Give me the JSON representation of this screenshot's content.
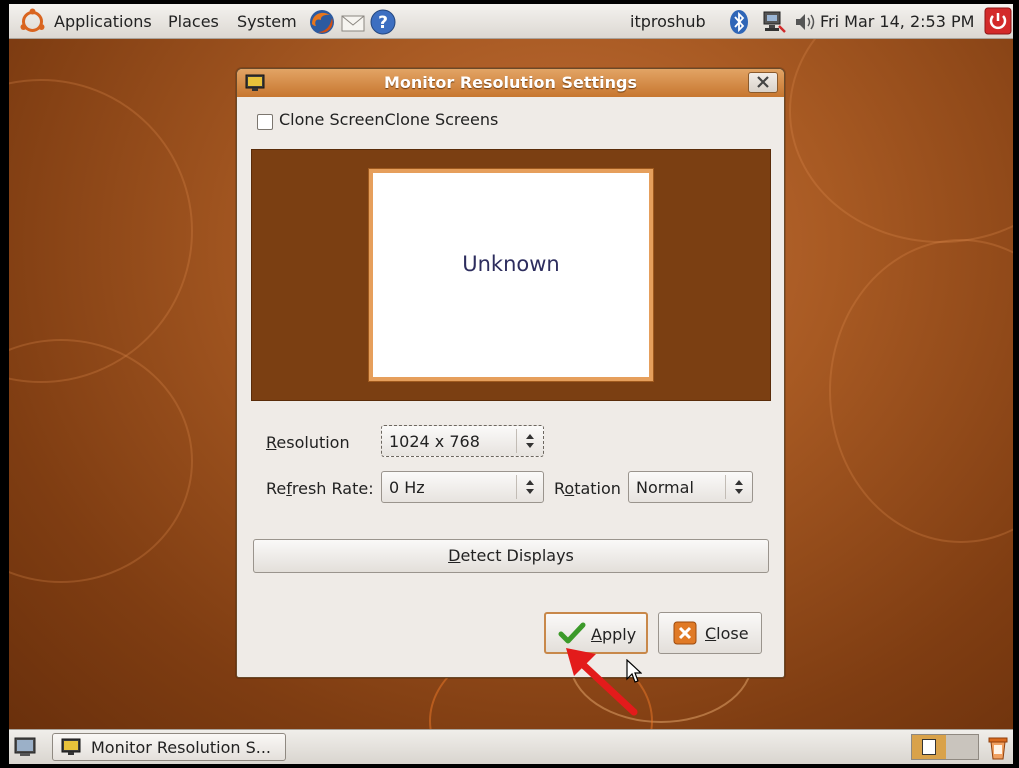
{
  "top_panel": {
    "menus": [
      "Applications",
      "Places",
      "System"
    ],
    "username": "itproshub",
    "clock": "Fri Mar 14,  2:53 PM"
  },
  "dialog": {
    "title": "Monitor Resolution Settings",
    "clone_screens_label": "Clone Screens",
    "clone_screens_checked": false,
    "monitor_name": "Unknown",
    "resolution_label": "Resolution",
    "resolution_value": "1024 x 768",
    "refresh_rate_label": "Refresh Rate:",
    "refresh_rate_value": "0 Hz",
    "rotation_label": "Rotation",
    "rotation_value": "Normal",
    "detect_displays_label": "Detect Displays",
    "apply_label": "Apply",
    "close_label": "Close"
  },
  "taskbar": {
    "window_button_label": "Monitor Resolution S..."
  },
  "colors": {
    "accent": "#c7762f",
    "desktop": "#a85a23",
    "arrow": "#e31b1b"
  },
  "icons": [
    "ubuntu-logo-icon",
    "firefox-icon",
    "mail-icon",
    "help-icon",
    "bluetooth-icon",
    "network-icon",
    "volume-icon",
    "shutdown-icon",
    "checkmark-icon",
    "close-x-icon",
    "show-desktop-icon",
    "workspace-switcher-icon",
    "trash-icon",
    "red-arrow-annotation"
  ]
}
